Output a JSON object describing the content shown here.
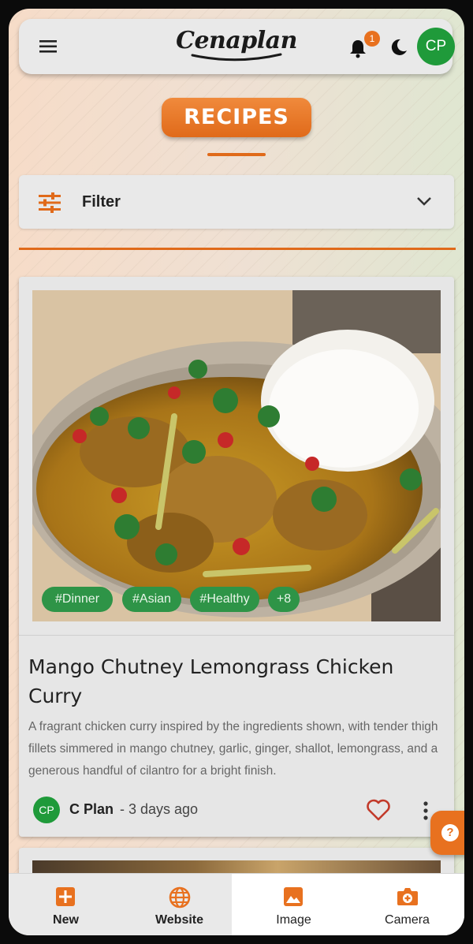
{
  "header": {
    "logo": "Cenaplan",
    "notification_count": "1",
    "avatar_initials": "CP"
  },
  "page": {
    "title": "RECIPES"
  },
  "filter": {
    "label": "Filter"
  },
  "recipe": {
    "tags": [
      "#Dinner",
      "#Asian",
      "#Healthy"
    ],
    "more_tags": "+8",
    "title": "Mango Chutney Lemongrass Chicken Curry",
    "description": "A fragrant chicken curry inspired by the ingredients shown, with tender thigh fillets simmered in mango chutney, garlic, ginger, shallot, lemongrass, and a generous handful of cilantro for a bright finish.",
    "author_initials": "CP",
    "author": "C Plan",
    "time": " - 3 days ago"
  },
  "help": {
    "label": "?"
  },
  "bottom_nav": {
    "items": [
      {
        "label": "New",
        "icon": "plus-box-icon",
        "active": false
      },
      {
        "label": "Website",
        "icon": "globe-icon",
        "active": false
      },
      {
        "label": "Image",
        "icon": "image-icon",
        "active": true
      },
      {
        "label": "Camera",
        "icon": "camera-plus-icon",
        "active": true
      }
    ]
  },
  "colors": {
    "accent": "#e06a1a",
    "green": "#1f9a3a",
    "tag_green": "#2e9447",
    "surface": "#e9e9e9"
  }
}
